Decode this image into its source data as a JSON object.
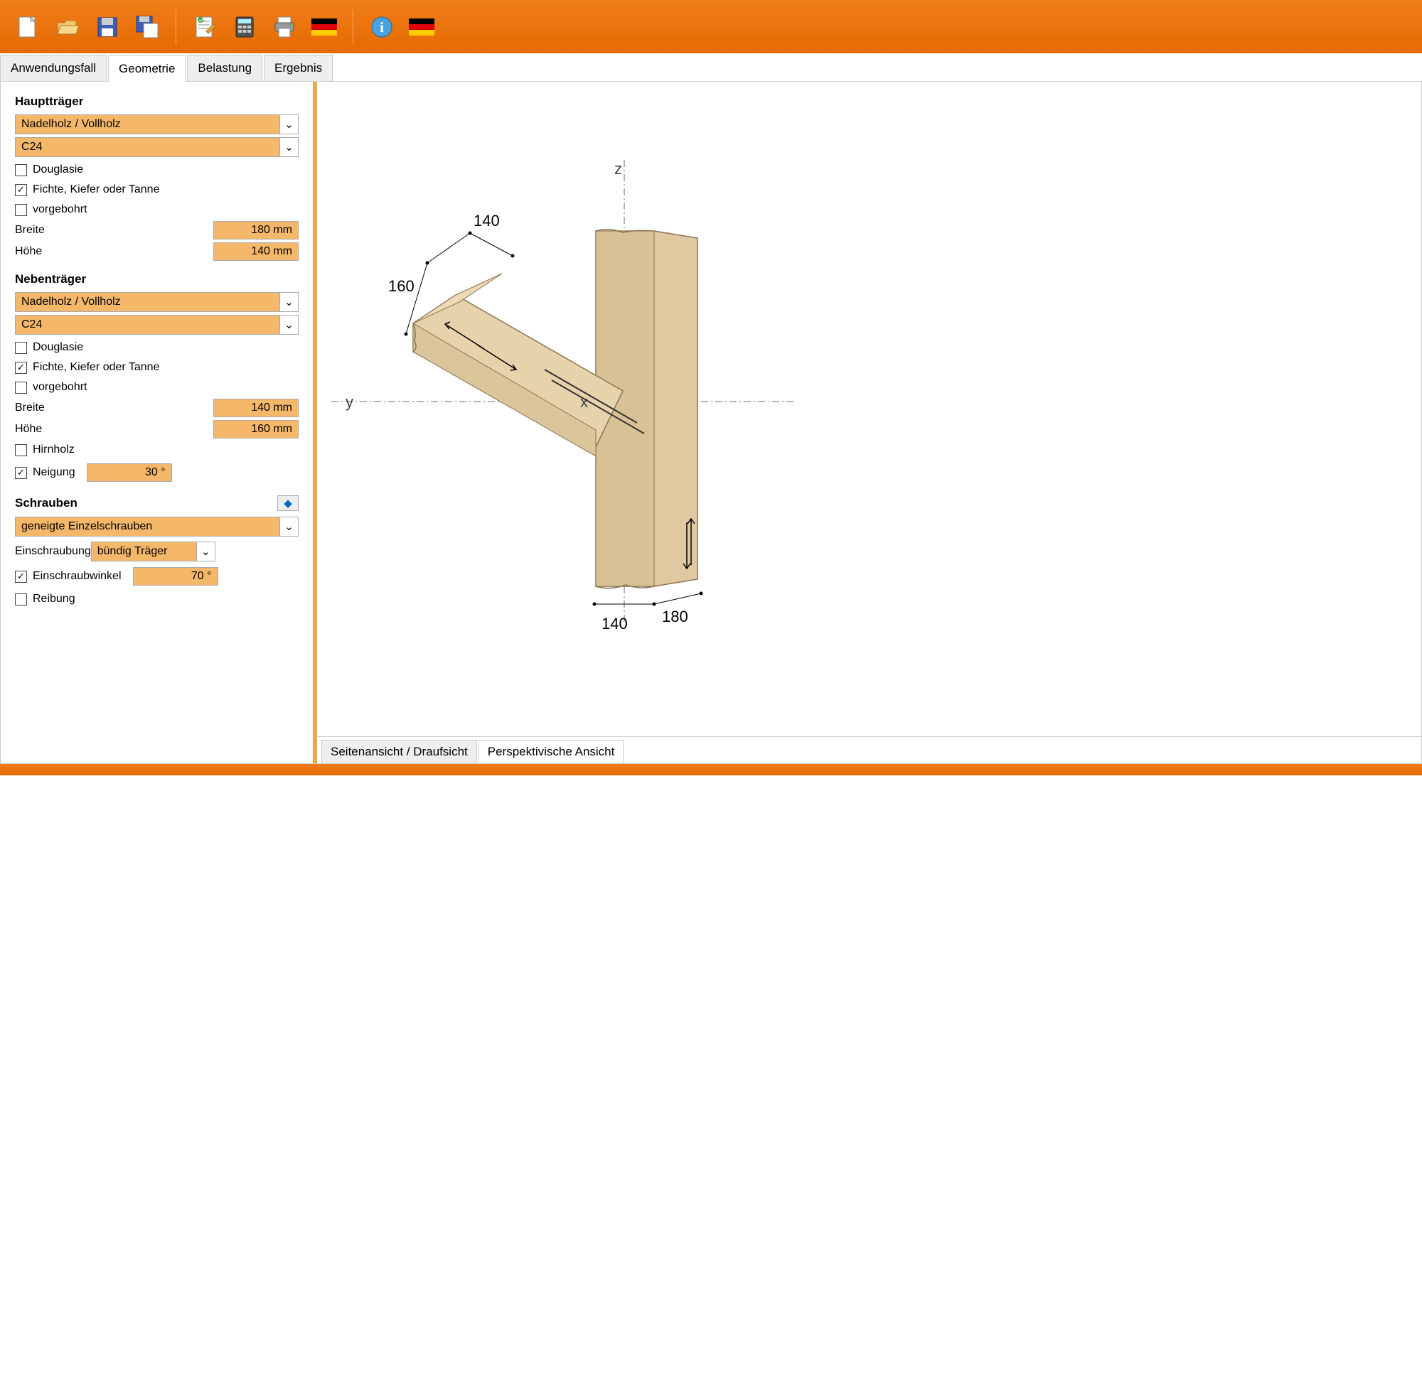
{
  "toolbar": {
    "icons": [
      "new-icon",
      "open-icon",
      "save-icon",
      "save-as-icon",
      "notes-icon",
      "calculate-icon",
      "print-icon",
      "flag-de-icon",
      "info-icon",
      "flag-de2-icon"
    ]
  },
  "tabs": {
    "items": [
      "Anwendungsfall",
      "Geometrie",
      "Belastung",
      "Ergebnis"
    ],
    "active": 1
  },
  "haupt": {
    "title": "Hauptträger",
    "sel1": "Nadelholz / Vollholz",
    "sel2": "C24",
    "chk_douglasie": "Douglasie",
    "chk_fichte": "Fichte, Kiefer oder Tanne",
    "chk_vorgebohrt": "vorgebohrt",
    "breite_label": "Breite",
    "breite_val": "180 mm",
    "hoehe_label": "Höhe",
    "hoehe_val": "140 mm"
  },
  "neben": {
    "title": "Nebenträger",
    "sel1": "Nadelholz / Vollholz",
    "sel2": "C24",
    "chk_douglasie": "Douglasie",
    "chk_fichte": "Fichte, Kiefer oder Tanne",
    "chk_vorgebohrt": "vorgebohrt",
    "breite_label": "Breite",
    "breite_val": "140 mm",
    "hoehe_label": "Höhe",
    "hoehe_val": "160 mm",
    "chk_hirnholz": "Hirnholz",
    "chk_neigung": "Neigung",
    "neigung_val": "30 °"
  },
  "schrauben": {
    "title": "Schrauben",
    "sel1": "geneigte Einzelschrauben",
    "einschraubung_label": "Einschraubung",
    "einschraubung_val": "bündig Träger",
    "chk_winkel": "Einschraubwinkel",
    "winkel_val": "70 °",
    "chk_reibung": "Reibung"
  },
  "viewtabs": {
    "items": [
      "Seitenansicht / Draufsicht",
      "Perspektivische Ansicht"
    ],
    "active": 1
  },
  "diagram": {
    "axes": {
      "x": "x",
      "y": "y",
      "z": "z"
    },
    "dims": {
      "d140a": "140",
      "d160": "160",
      "d140b": "140",
      "d180": "180"
    }
  }
}
